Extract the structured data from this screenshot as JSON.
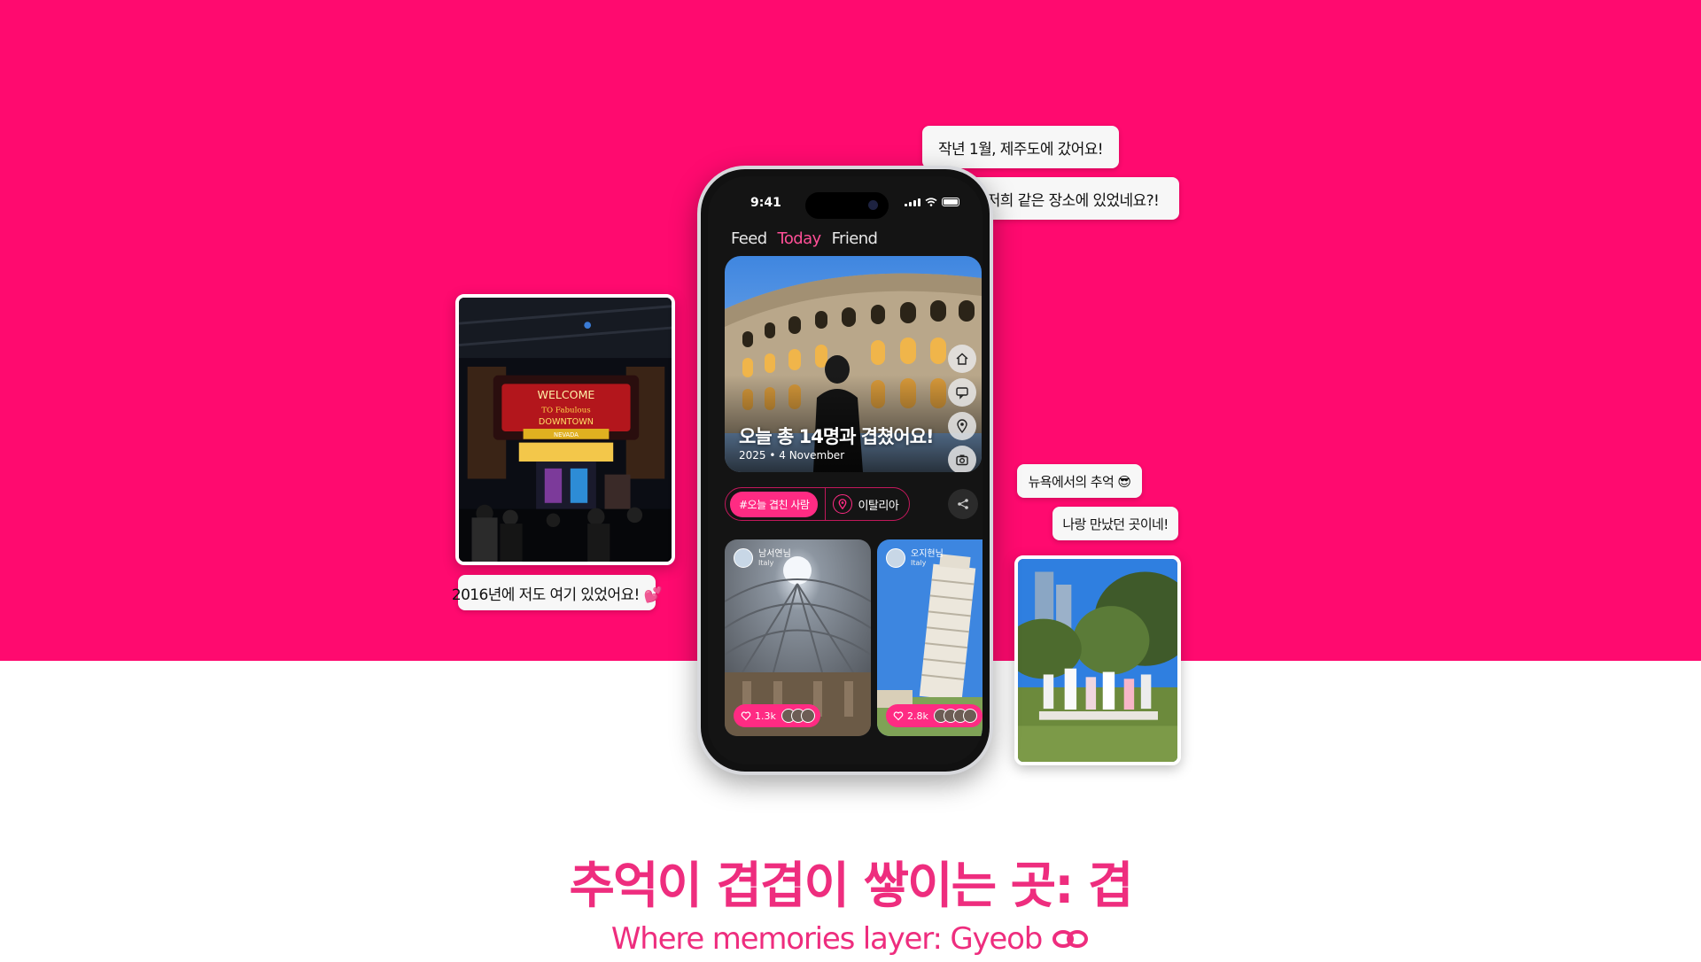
{
  "bubbles": {
    "jeju": "작년 1월, 제주도에 갔어요!",
    "same_place": "저희 같은 장소에 있었네요?!",
    "nyc": "뉴욕에서의 추억 😎",
    "met": "나랑 만났던 곳이네!",
    "vegas": "2016년에 저도 여기 있었어요! 💕"
  },
  "phone": {
    "status_time": "9:41",
    "tabs": [
      {
        "label": "Feed",
        "active": false
      },
      {
        "label": "Today",
        "active": true
      },
      {
        "label": "Friend",
        "active": false
      }
    ],
    "hero": {
      "title": "오늘 총 14명과 겹쳤어요!",
      "date": "2025 • 4 November",
      "actions": [
        "home-icon",
        "chat-icon",
        "location-pin-icon",
        "camera-icon"
      ]
    },
    "chips": {
      "tag": "#오늘 겹친 사람",
      "location": "이탈리아"
    },
    "posts": [
      {
        "user": "남서연님",
        "location": "Italy",
        "likes": "1.3k"
      },
      {
        "user": "오지현님",
        "location": "Italy",
        "likes": "2.8k"
      }
    ]
  },
  "headline": "추억이 겹겹이 쌓이는 곳: 겹",
  "subline": "Where memories layer: Gyeob",
  "colors": {
    "brand_pink": "#ff0a6f",
    "text_pink": "#ee2d7e",
    "active_tab": "#ff4f97"
  }
}
